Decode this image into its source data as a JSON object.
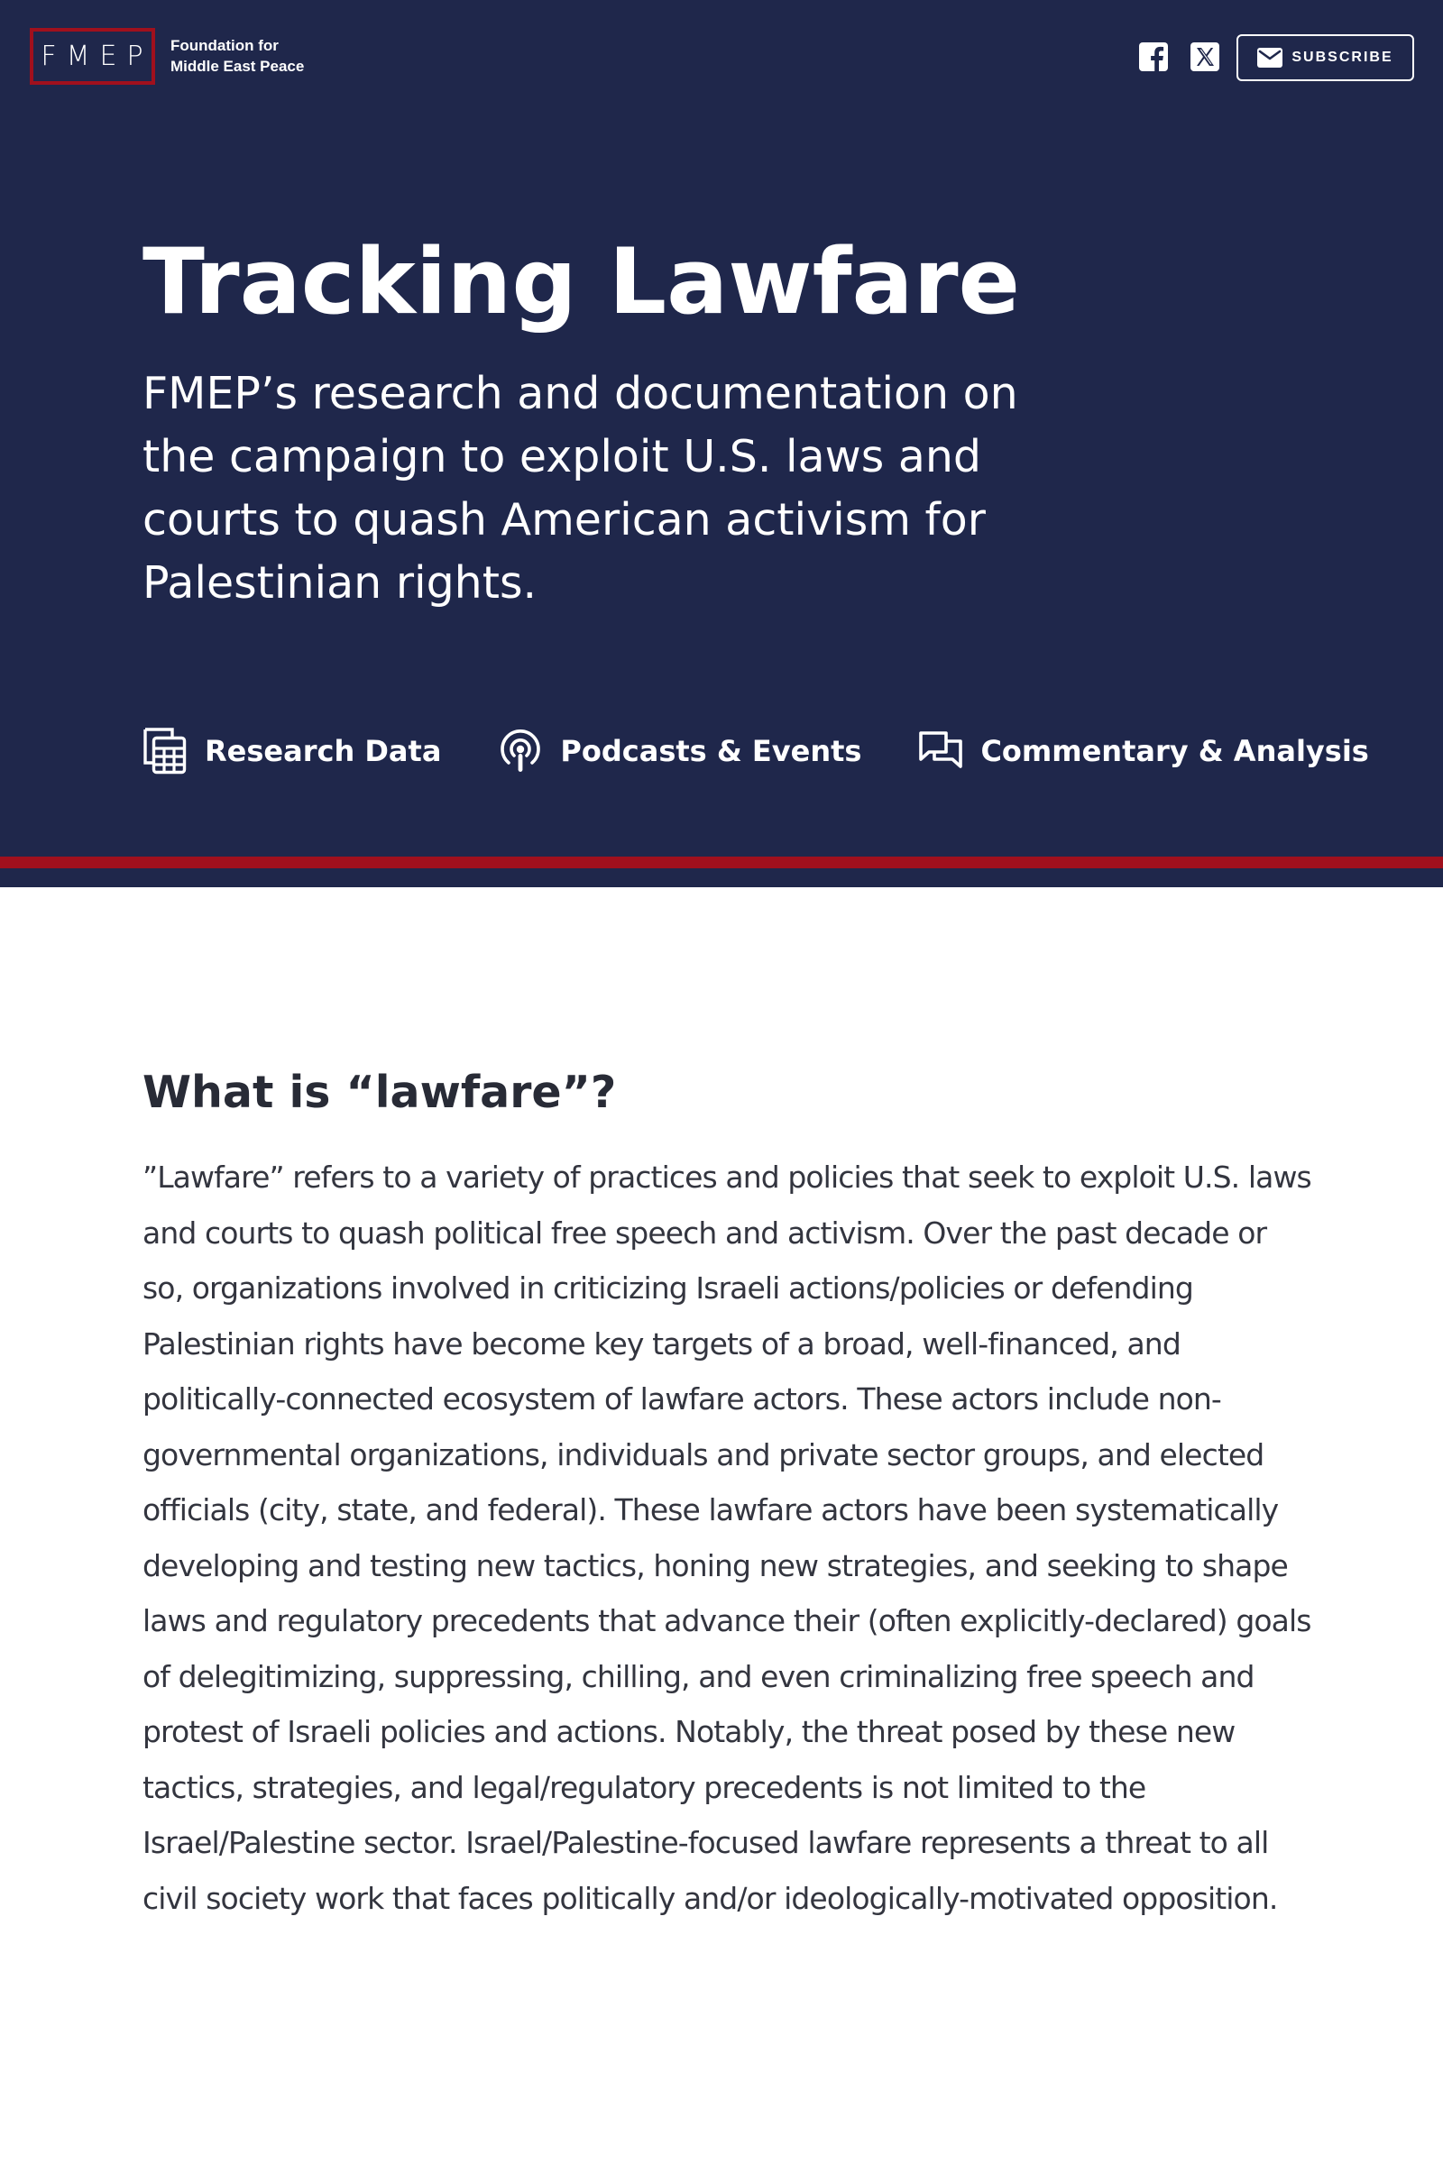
{
  "header": {
    "logo_text": "FMEP",
    "org_name_line1": "Foundation for",
    "org_name_line2": "Middle East Peace",
    "social": [
      {
        "icon": "facebook-icon"
      },
      {
        "icon": "x-twitter-icon"
      }
    ],
    "subscribe_label": "SUBSCRIBE",
    "subscribe_icon": "envelope-icon"
  },
  "hero": {
    "title": "Tracking Lawfare",
    "subtitle": "FMEP’s research and documentation on the campaign to exploit U.S. laws and courts to quash American activism for Palestinian rights."
  },
  "nav": {
    "items": [
      {
        "label": "Research Data",
        "icon": "spreadsheet-icon"
      },
      {
        "label": "Podcasts & Events",
        "icon": "podcast-icon"
      },
      {
        "label": "Commentary & Analysis",
        "icon": "chat-bubbles-icon"
      }
    ]
  },
  "content": {
    "heading": "What is “lawfare”?",
    "body": "”Lawfare” refers to a variety of practices and policies that seek to exploit U.S. laws and courts to quash political free speech and activism. Over the past decade or so, organizations involved in criticizing Israeli actions/policies or defending Palestinian rights have become key targets of a broad, well-financed, and politically-connected ecosystem of lawfare actors. These actors include non-governmental organizations, individuals and private sector groups, and elected officials (city, state, and federal). These lawfare actors have been systematically developing and testing new tactics, honing new strategies, and seeking to shape laws and regulatory precedents that advance their (often explicitly-declared) goals of delegitimizing, suppressing, chilling, and even criminalizing free speech and protest of Israeli policies and actions. Notably, the threat posed by these new tactics, strategies, and legal/regulatory precedents is not limited to the Israel/Palestine sector. Israel/Palestine-focused lawfare represents a threat to all civil society work that faces politically and/or ideologically-motivated opposition."
  },
  "colors": {
    "navy": "#1f274b",
    "brand_red": "#a0101d",
    "text_dark": "#282b36"
  }
}
